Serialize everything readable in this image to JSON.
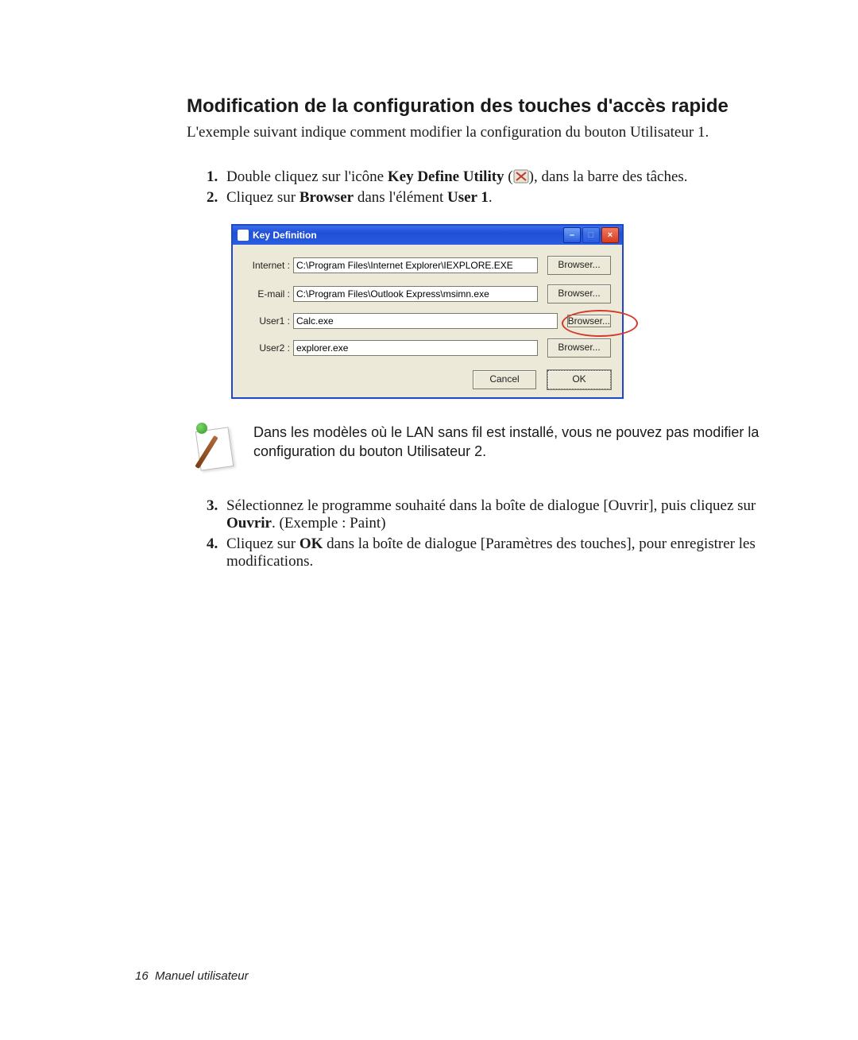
{
  "heading": "Modification de la configuration des touches d'accès rapide",
  "intro": "L'exemple suivant indique comment modifier la configuration du bouton Utilisateur 1.",
  "step1_a": "Double cliquez sur l'icône ",
  "step1_b": "Key Define Utility",
  "step1_c": " (",
  "step1_d": "), dans la barre des tâches.",
  "step2_a": "Cliquez sur ",
  "step2_b": "Browser",
  "step2_c": " dans l'élément ",
  "step2_d": "User 1",
  "step2_e": ".",
  "step3_a": "Sélectionnez le programme souhaité dans la boîte de dialogue [Ouvrir], puis cliquez sur ",
  "step3_b": "Ouvrir",
  "step3_c": ". (Exemple : Paint)",
  "step4_a": "Cliquez sur ",
  "step4_b": "OK",
  "step4_c": " dans la boîte de dialogue [Paramètres des touches], pour enregistrer les modifications.",
  "note": "Dans les modèles où le LAN sans fil est installé, vous ne pouvez pas modifier la configuration du bouton Utilisateur 2.",
  "footer_page": "16",
  "footer_text": "Manuel utilisateur",
  "dialog": {
    "title": "Key Definition",
    "rows": [
      {
        "label": "Internet :",
        "value": "C:\\Program Files\\Internet Explorer\\IEXPLORE.EXE",
        "btn": "Browser..."
      },
      {
        "label": "E-mail :",
        "value": "C:\\Program Files\\Outlook Express\\msimn.exe",
        "btn": "Browser..."
      },
      {
        "label": "User1 :",
        "value": "Calc.exe",
        "btn": "Browser..."
      },
      {
        "label": "User2 :",
        "value": "explorer.exe",
        "btn": "Browser..."
      }
    ],
    "cancel": "Cancel",
    "ok": "OK"
  }
}
